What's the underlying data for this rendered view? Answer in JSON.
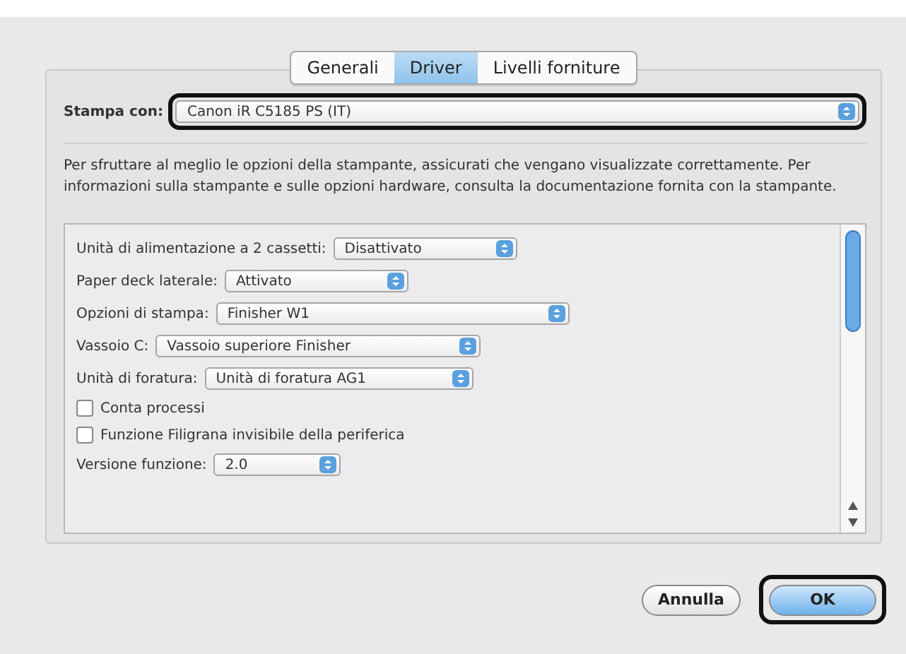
{
  "tabs": [
    {
      "label": "Generali",
      "selected": false
    },
    {
      "label": "Driver",
      "selected": true
    },
    {
      "label": "Livelli forniture",
      "selected": false
    }
  ],
  "printer": {
    "label": "Stampa con:",
    "value": "Canon iR C5185 PS (IT)",
    "highlighted": true
  },
  "description": "Per sfruttare al meglio le opzioni della stampante, assicurati che vengano visualizzate correttamente. Per informazioni sulla stampante e sulle opzioni hardware, consulta la documentazione fornita con la stampante.",
  "options": [
    {
      "kind": "select",
      "label": "Unità di alimentazione a 2 cassetti:",
      "value": "Disattivato"
    },
    {
      "kind": "select",
      "label": "Paper deck laterale:",
      "value": "Attivato"
    },
    {
      "kind": "select",
      "label": "Opzioni di stampa:",
      "value": "Finisher W1"
    },
    {
      "kind": "select",
      "label": "Vassoio C:",
      "value": "Vassoio superiore Finisher"
    },
    {
      "kind": "select",
      "label": "Unità di foratura:",
      "value": "Unità di foratura AG1"
    },
    {
      "kind": "checkbox",
      "label": "Conta processi",
      "checked": false
    },
    {
      "kind": "checkbox",
      "label": "Funzione Filigrana invisibile della periferica",
      "checked": false
    },
    {
      "kind": "select",
      "label": "Versione funzione:",
      "value": "2.0"
    }
  ],
  "buttons": [
    {
      "label": "Annulla",
      "default": false,
      "highlighted": false
    },
    {
      "label": "OK",
      "default": true,
      "highlighted": true
    }
  ]
}
